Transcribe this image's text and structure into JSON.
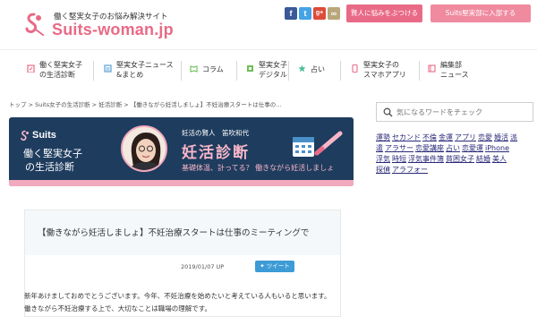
{
  "header": {
    "tagline": "働く堅実女子のお悩み解決サイト",
    "logo": "Suits-woman.jp",
    "social": [
      {
        "name": "facebook",
        "glyph": "f",
        "color": "#3b5998"
      },
      {
        "name": "twitter",
        "glyph": "t",
        "color": "#45a3e5"
      },
      {
        "name": "google-plus",
        "glyph": "g+",
        "color": "#dd4b39"
      },
      {
        "name": "feedly",
        "glyph": "∞",
        "color": "#b8a77a"
      }
    ],
    "btn_ask": "賢人に悩みをぶつける",
    "btn_join": "Suits堅実部に入部する"
  },
  "nav": [
    {
      "label1": "働く堅実女子",
      "label2": "の生活診断",
      "icon": "clipboard-icon"
    },
    {
      "label1": "堅実女子ニュース",
      "label2": "&まとめ",
      "icon": "news-icon"
    },
    {
      "label1": "コラム",
      "label2": "",
      "icon": "book-icon"
    },
    {
      "label1": "堅実女子",
      "label2": "デジタル",
      "icon": "digital-icon"
    },
    {
      "label1": "占い",
      "label2": "",
      "icon": "star-icon"
    },
    {
      "label1": "堅実女子の",
      "label2": "スマホアプリ",
      "icon": "phone-icon"
    },
    {
      "label1": "編集部",
      "label2": "ニュース",
      "icon": "notebook-icon"
    }
  ],
  "breadcrumb": [
    "トップ",
    "Suits女子の生活診断",
    "妊活診断",
    "【働きながら妊活しましょ】不妊治療スタートは仕事の…"
  ],
  "banner": {
    "brand": "Suits",
    "title_line1": "働く堅実女子",
    "title_line2": "の生活診断",
    "author": "妊活の賢人　笛吹和代",
    "heading": "妊活診断",
    "sub": "基礎体温、計ってる？ 働きながら妊活しましょ"
  },
  "article": {
    "headline": "【働きながら妊活しましょ】不妊治療スタートは仕事のミーティングで",
    "date": "2019/01/07 UP",
    "tweet": "ツイート",
    "para1": "新年あけましておめでとうございます。今年、不妊治療を始めたいと考えている人もいると思います。",
    "para2": "働きながら不妊治療する上で、大切なことは職場の理解です。"
  },
  "sidebar": {
    "search_placeholder": "気になるワードをチェック",
    "tag_lines": [
      [
        "運勢",
        "セカンド",
        "不倫",
        "金運",
        "アプリ",
        "恋愛",
        "婚活",
        "派"
      ],
      [
        "遣",
        "アラサー",
        "恋愛講座",
        "占い",
        "恋愛運",
        "iPhone"
      ],
      [
        "浮気",
        "時短",
        "浮気事件簿",
        "貧困女子",
        "結婚",
        "美人"
      ],
      [
        "探偵",
        "アラフォー"
      ]
    ]
  },
  "colors": {
    "brand_pink": "#e96a86",
    "banner_navy": "#1e3c5e",
    "banner_pink": "#f3a9bd",
    "btn_ask": "#e96a86",
    "btn_join": "#f08a9f",
    "tweet_blue": "#3d9bd6"
  }
}
